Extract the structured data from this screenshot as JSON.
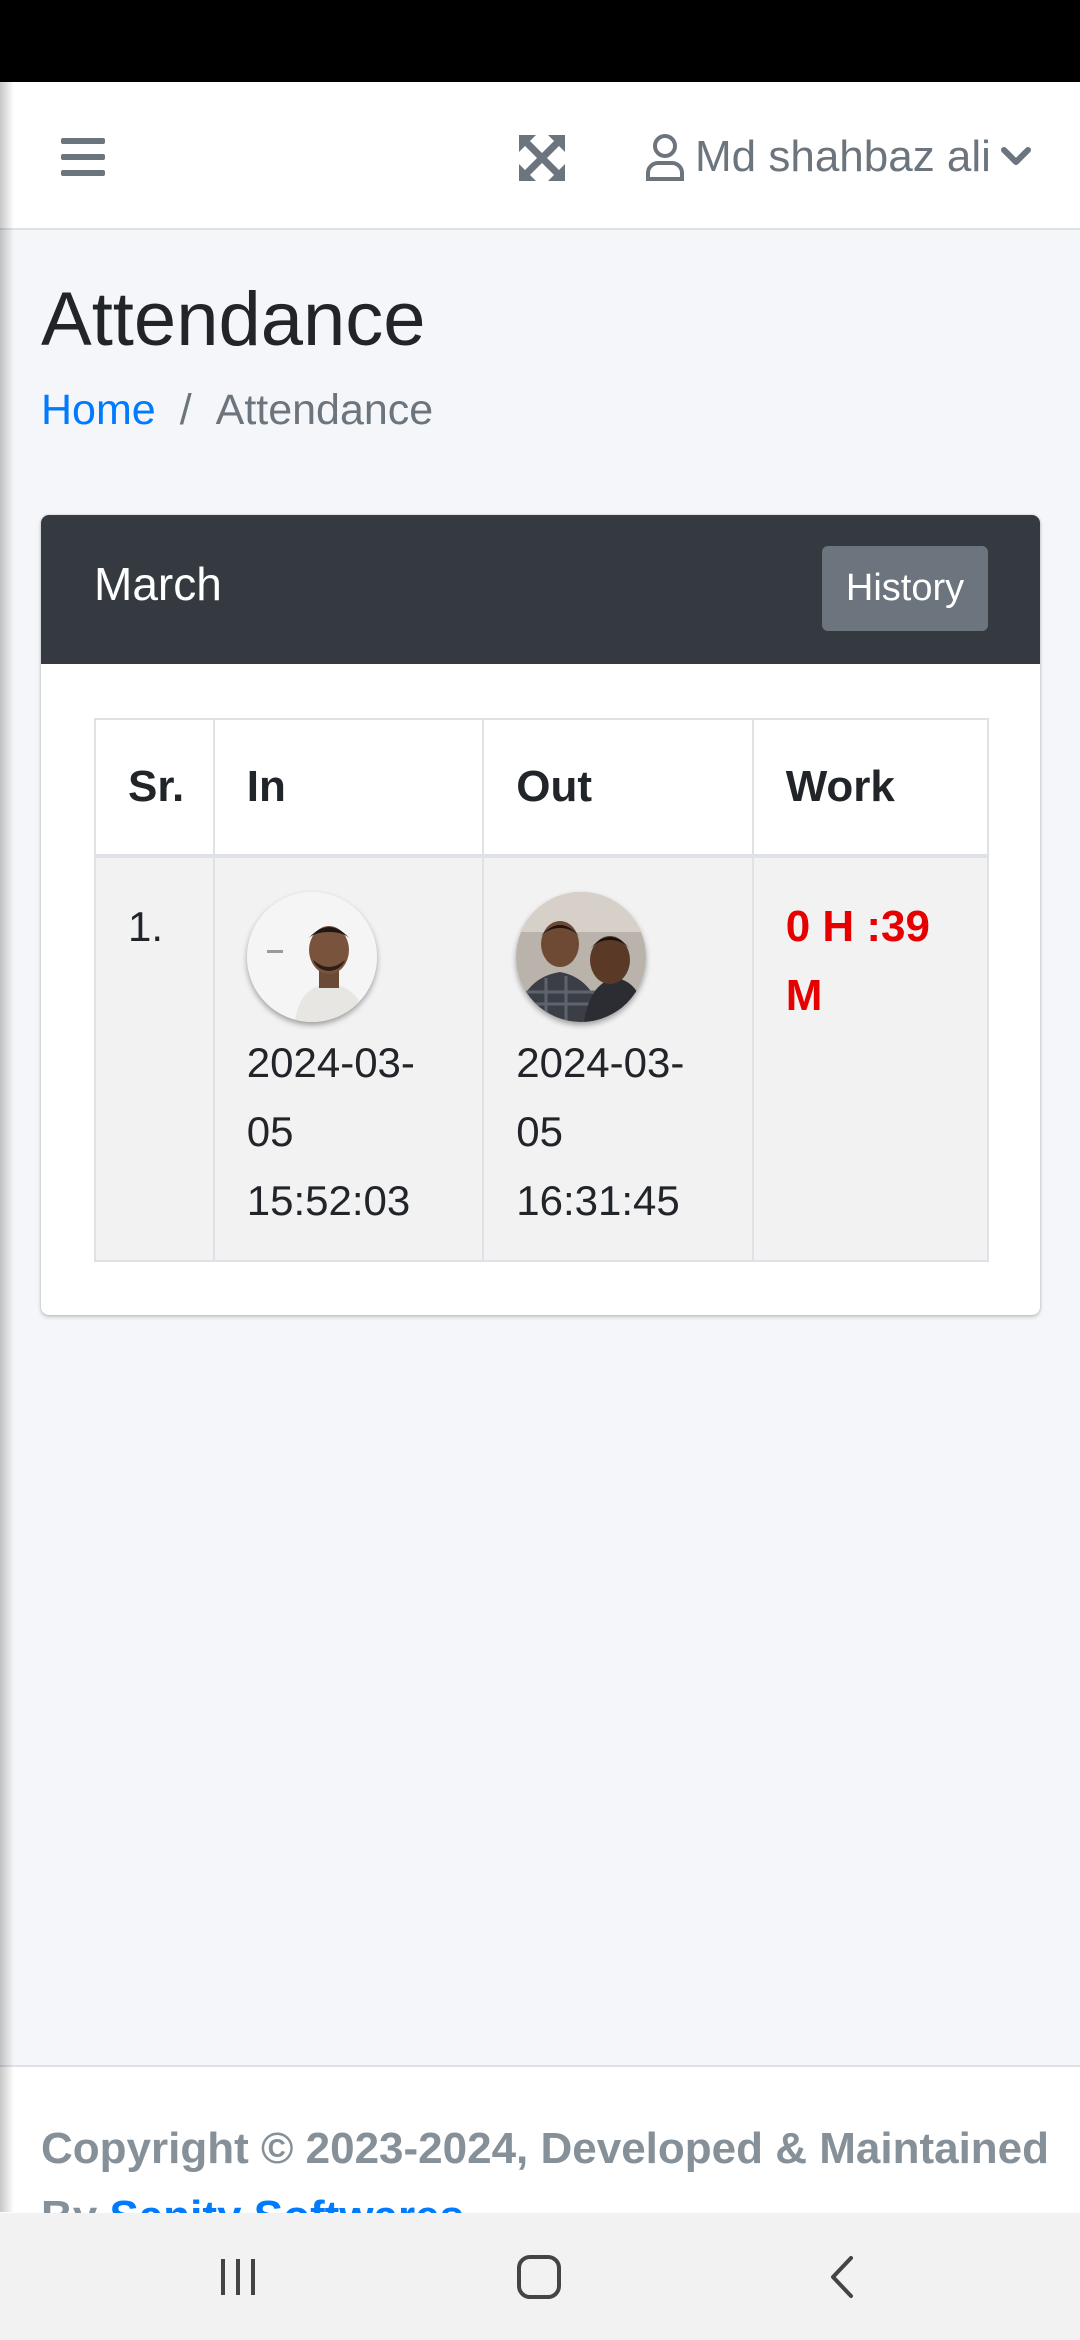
{
  "navbar": {
    "menu_icon": "hamburger-menu-icon",
    "fullscreen_icon": "expand-arrows-icon",
    "user_icon": "user-outline-icon",
    "user_name": "Md shahbaz ali",
    "dropdown_icon": "chevron-down-icon"
  },
  "page": {
    "title": "Attendance",
    "breadcrumb": {
      "home": "Home",
      "separator": "/",
      "current": "Attendance"
    }
  },
  "card": {
    "title": "March",
    "history_button": "History",
    "header_color": "#343a40"
  },
  "table": {
    "headers": {
      "sr": "Sr.",
      "in": "In",
      "out": "Out",
      "work": "Work"
    },
    "rows": [
      {
        "sr": "1.",
        "in_photo": "check-in-selfie-photo",
        "in_date": "2024-03-",
        "in_day": "05",
        "in_time": "15:52:03",
        "out_photo": "check-out-selfie-photo",
        "out_date": "2024-03-",
        "out_day": "05",
        "out_time": "16:31:45",
        "work_hours": "0 H :39",
        "work_minutes": "M"
      }
    ]
  },
  "footer": {
    "copyright": "Copyright © 2023-2024, Developed & Maintained",
    "by": "By",
    "developer": "Sanity Softwares"
  },
  "colors": {
    "link": "#007bff",
    "work_time": "#e60000",
    "button": "#6c757d",
    "background": "#f4f6f9"
  },
  "system_nav": {
    "recents_icon": "recent-apps-icon",
    "home_icon": "home-square-icon",
    "back_icon": "back-chevron-icon"
  }
}
